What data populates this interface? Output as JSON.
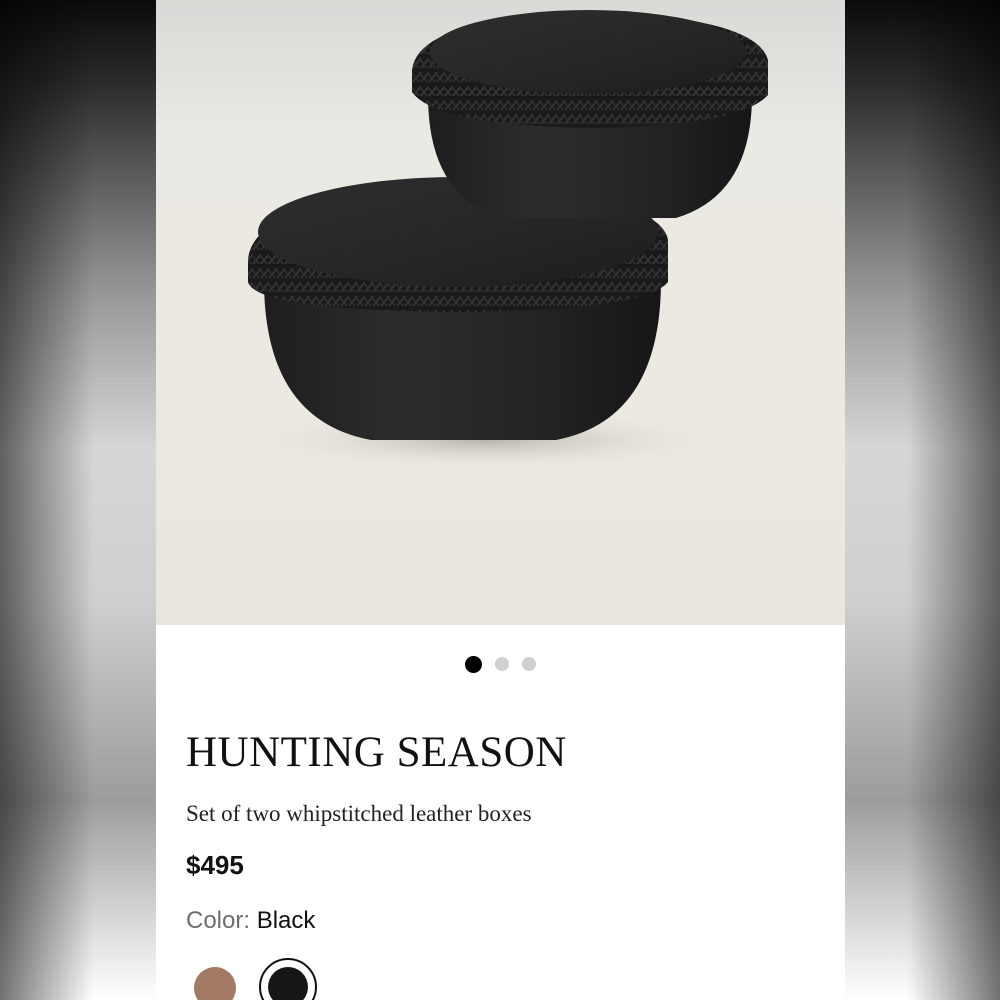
{
  "carousel": {
    "slides": 3,
    "active_index": 0
  },
  "product": {
    "brand": "HUNTING SEASON",
    "description": "Set of two whipstitched leather boxes",
    "price": "$495",
    "color_label": "Color:",
    "color_value": "Black",
    "swatches": [
      {
        "name": "brown",
        "color": "#a37a63",
        "selected": false
      },
      {
        "name": "black",
        "color": "#161616",
        "selected": true
      }
    ]
  },
  "colors": {
    "background": "#ffffff",
    "text": "#111111",
    "muted_text": "#6e6e6e",
    "dot_active": "#000000",
    "dot_inactive": "#d0d0d0"
  }
}
